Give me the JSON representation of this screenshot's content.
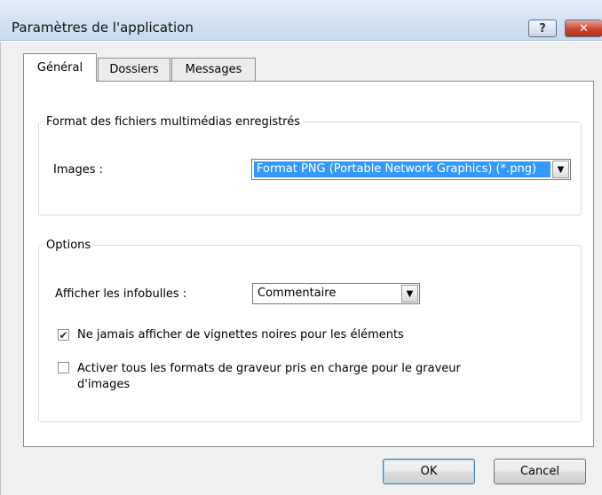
{
  "window": {
    "title": "Paramètres de l'application",
    "help_symbol": "?",
    "close_symbol": "✕"
  },
  "tabs": [
    {
      "label": "Général",
      "active": true
    },
    {
      "label": "Dossiers",
      "active": false
    },
    {
      "label": "Messages",
      "active": false
    }
  ],
  "media_group": {
    "title": "Format des fichiers multimédias enregistrés",
    "images_label": "Images :",
    "images_value": "Format PNG (Portable Network Graphics) (*.png)"
  },
  "options_group": {
    "title": "Options",
    "tooltips_label": "Afficher les infobulles :",
    "tooltips_value": "Commentaire",
    "checkbox1": {
      "label": "Ne jamais afficher de vignettes noires pour les éléments",
      "checked": true
    },
    "checkbox2": {
      "label_line1": "Activer tous les formats de graveur pris en charge pour le graveur",
      "label_line2": "d'images",
      "checked": false
    }
  },
  "buttons": {
    "ok": "OK",
    "cancel": "Cancel"
  },
  "icons": {
    "dropdown_arrow": "▼",
    "check_mark": "✔"
  },
  "colors": {
    "selection": "#3399ff",
    "close_button": "#c9452e"
  }
}
